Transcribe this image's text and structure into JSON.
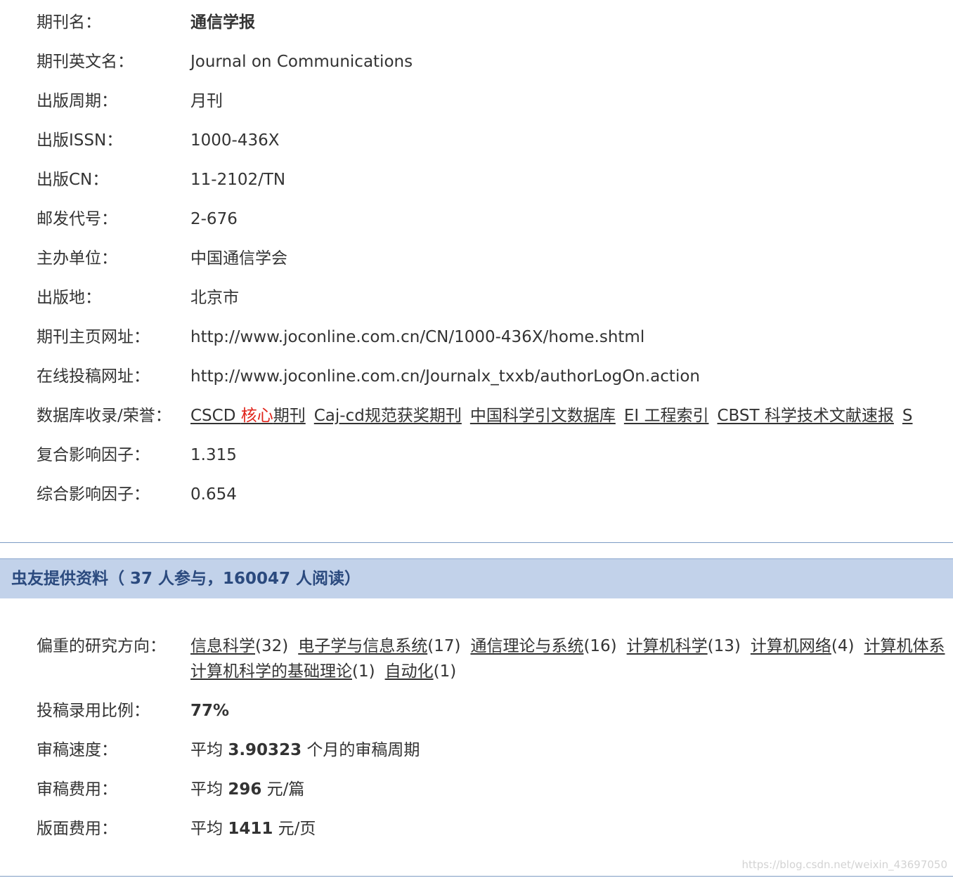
{
  "journal": {
    "rows": [
      {
        "label": "期刊名：",
        "value": "通信学报"
      },
      {
        "label": "期刊英文名：",
        "value": "Journal on Communications"
      },
      {
        "label": "出版周期：",
        "value": "月刊"
      },
      {
        "label": "出版ISSN：",
        "value": "1000-436X"
      },
      {
        "label": "出版CN：",
        "value": "11-2102/TN"
      },
      {
        "label": "邮发代号：",
        "value": "2-676"
      },
      {
        "label": "主办单位：",
        "value": "中国通信学会"
      },
      {
        "label": "出版地：",
        "value": "北京市"
      },
      {
        "label": "期刊主页网址：",
        "value": "http://www.joconline.com.cn/CN/1000-436X/home.shtml"
      },
      {
        "label": "在线投稿网址：",
        "value": "http://www.joconline.com.cn/Journalx_txxb/authorLogOn.action"
      },
      {
        "label": "数据库收录/荣誉：",
        "value": ""
      },
      {
        "label": "复合影响因子：",
        "value": "1.315"
      },
      {
        "label": "综合影响因子：",
        "value": "0.654"
      }
    ],
    "honors": {
      "cscd_prefix": "CSCD ",
      "cscd_core": "核心",
      "cscd_suffix": "期刊",
      "items": [
        "Caj-cd规范获奖期刊",
        "中国科学引文数据库",
        "EI 工程索引",
        "CBST 科学技术文献速报",
        "S"
      ]
    }
  },
  "section": {
    "header": "虫友提供资料（ 37 人参与，160047 人阅读）"
  },
  "contrib": {
    "research_label": "偏重的研究方向：",
    "research_line1": [
      {
        "name": "信息科学",
        "count": "(32)"
      },
      {
        "name": "电子学与信息系统",
        "count": "(17)"
      },
      {
        "name": "通信理论与系统",
        "count": "(16)"
      },
      {
        "name": "计算机科学",
        "count": "(13)"
      },
      {
        "name": "计算机网络",
        "count": "(4)"
      },
      {
        "name": "计算机体系",
        "count": ""
      }
    ],
    "research_line2": [
      {
        "name": "计算机科学的基础理论",
        "count": "(1)"
      },
      {
        "name": "自动化",
        "count": "(1)"
      }
    ],
    "accept_label": "投稿录用比例：",
    "accept_value": "77%",
    "review_speed_label": "审稿速度：",
    "review_speed_prefix": "平均 ",
    "review_speed_value": "3.90323",
    "review_speed_suffix": " 个月的审稿周期",
    "review_fee_label": "审稿费用：",
    "review_fee_prefix": "平均 ",
    "review_fee_value": "296",
    "review_fee_suffix": " 元/篇",
    "page_fee_label": "版面费用：",
    "page_fee_prefix": "平均 ",
    "page_fee_value": "1411",
    "page_fee_suffix": " 元/页"
  },
  "watermark": "https://blog.csdn.net/weixin_43697050"
}
